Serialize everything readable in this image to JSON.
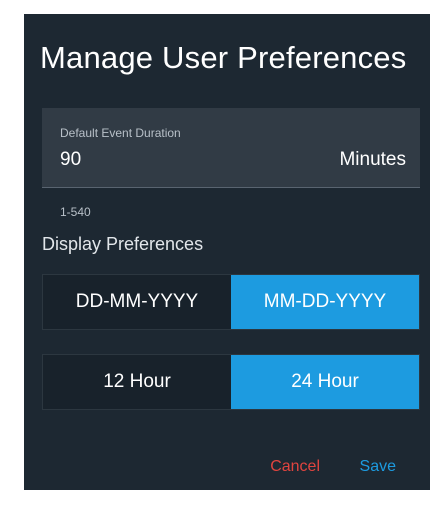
{
  "dialog": {
    "title": "Manage User Preferences"
  },
  "duration_field": {
    "label": "Default Event Duration",
    "value": "90",
    "unit": "Minutes",
    "helper": "1-540"
  },
  "display_preferences": {
    "label": "Display Preferences",
    "date_format": {
      "options": [
        "DD-MM-YYYY",
        "MM-DD-YYYY"
      ],
      "selected": "MM-DD-YYYY"
    },
    "time_format": {
      "options": [
        "12 Hour",
        "24 Hour"
      ],
      "selected": "24 Hour"
    }
  },
  "actions": {
    "cancel_label": "Cancel",
    "save_label": "Save"
  },
  "colors": {
    "background": "#1d2832",
    "field_background": "#313b45",
    "accent": "#1d9be0",
    "danger": "#e0443f"
  }
}
